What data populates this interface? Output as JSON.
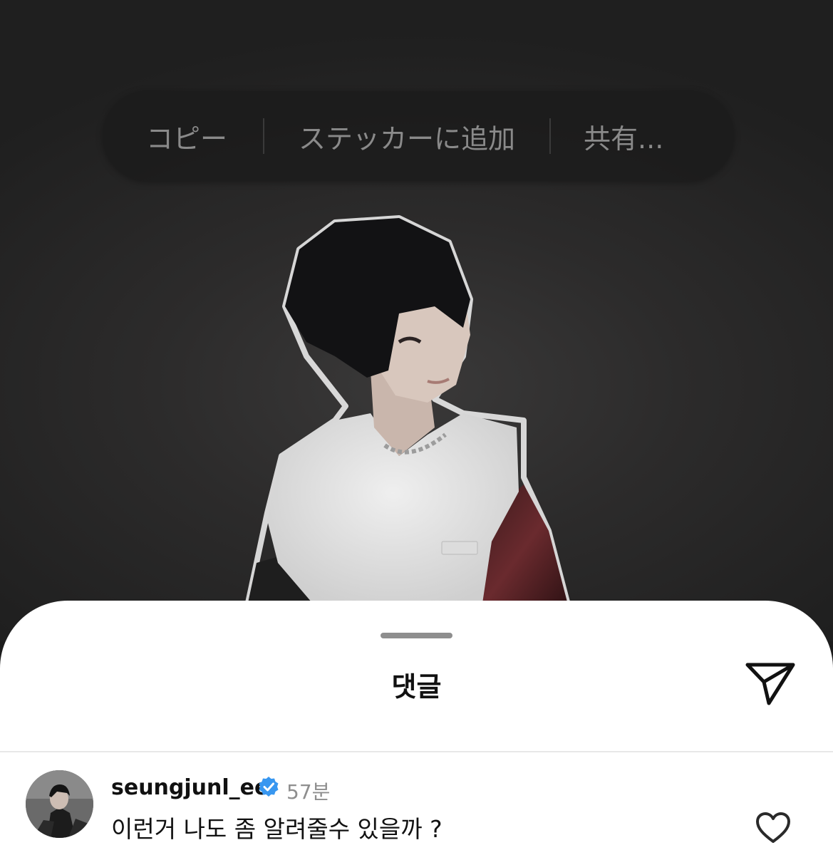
{
  "context_menu": {
    "items": [
      {
        "label": "コピー"
      },
      {
        "label": "ステッカーに追加"
      },
      {
        "label": "共有..."
      }
    ]
  },
  "photo": {
    "icon": "person-photo"
  },
  "sheet": {
    "title": "댓글",
    "share_icon": "paper-plane-icon"
  },
  "comment": {
    "username": "seungjunl_ee",
    "verified_icon": "verified-badge-icon",
    "timestamp": "57분",
    "text": "이런거 나도 좀 알려줄수 있을까 ?",
    "like_icon": "heart-icon"
  },
  "colors": {
    "verified": "#3897f0",
    "menu_text": "#8a8a8a",
    "muted_text": "#8e8e8e"
  }
}
